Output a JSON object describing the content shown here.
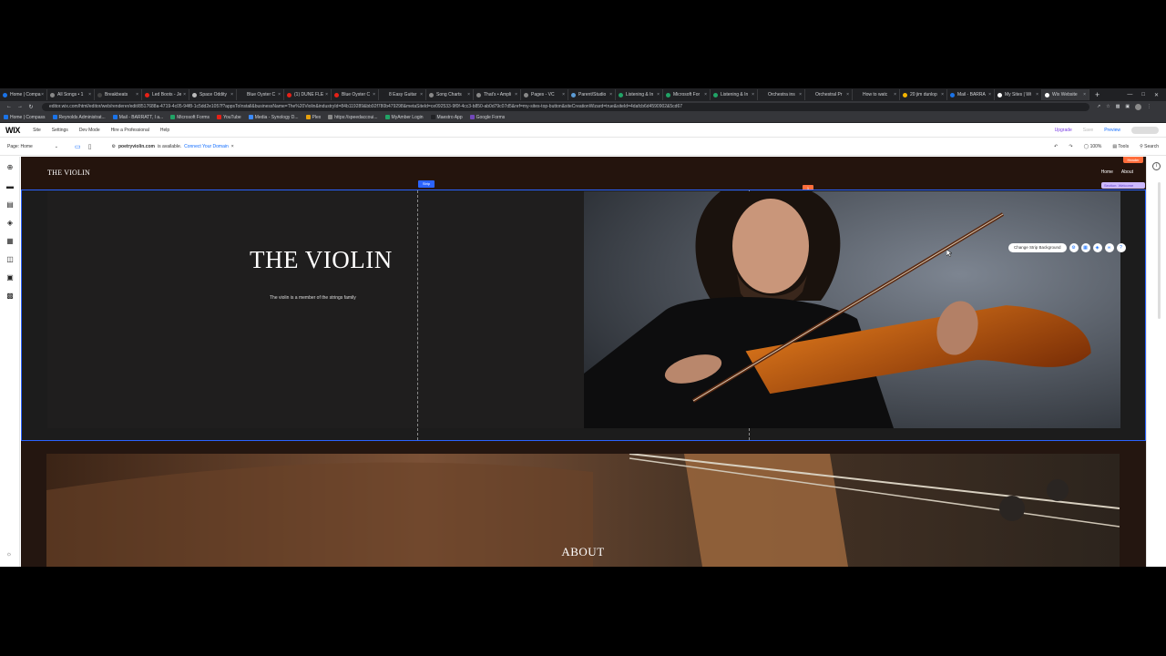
{
  "browser": {
    "tabs": [
      {
        "label": "Home | Compa",
        "color": "#1a73e8",
        "active": false
      },
      {
        "label": "All Songs • 1",
        "color": "#888888",
        "active": false
      },
      {
        "label": "Breakbeats",
        "color": "#444444",
        "active": false
      },
      {
        "label": "Led Boots - Je",
        "color": "#e62117",
        "active": false
      },
      {
        "label": "Space Oddity",
        "color": "#bbbbbb",
        "active": false
      },
      {
        "label": "Blue Oyster C",
        "color": "#202124",
        "active": false
      },
      {
        "label": "(1) DUNE FLE",
        "color": "#e62117",
        "active": false
      },
      {
        "label": "Blue Oyster C",
        "color": "#e62117",
        "active": false
      },
      {
        "label": "8 Easy Guitar",
        "color": "#202124",
        "active": false
      },
      {
        "label": "Song Charts",
        "color": "#888888",
        "active": false
      },
      {
        "label": "That's • Ampli",
        "color": "#888888",
        "active": false
      },
      {
        "label": "Pages - VC",
        "color": "#888888",
        "active": false
      },
      {
        "label": "Parent/Studio",
        "color": "#5b9bd5",
        "active": false
      },
      {
        "label": "Listening & In",
        "color": "#21a366",
        "active": false
      },
      {
        "label": "Microsoft For",
        "color": "#21a366",
        "active": false
      },
      {
        "label": "Listening & In",
        "color": "#21a366",
        "active": false
      },
      {
        "label": "Orchestra ins",
        "color": "#202124",
        "active": false
      },
      {
        "label": "Orchestral Pr",
        "color": "#202124",
        "active": false
      },
      {
        "label": "How to watc",
        "color": "#202124",
        "active": false
      },
      {
        "label": "20 jim dunlop",
        "color": "#f4b400",
        "active": false
      },
      {
        "label": "Mail - BARRA",
        "color": "#1a73e8",
        "active": false
      },
      {
        "label": "My Sites | Wi",
        "color": "#ffffff",
        "active": false
      },
      {
        "label": "Wix Website",
        "color": "#ffffff",
        "active": true
      }
    ],
    "url": "editor.wix.com/html/editor/web/renderer/edit/8517688a-4719-4c05-94f8-1c5dd2e1057f?appsToInstall&businessName=The%20Violin&industryId=84b119289&bb92f780b479298&metaSiteId=ce092533-9f0f-4cc3-b850-ab0d79c07d5&ref=my-sites-top-button&siteCreationWizard=true&siteId=4dafcb6d4590902&5cd67",
    "bookmarks": [
      {
        "label": "Home | Compass",
        "color": "#1a73e8"
      },
      {
        "label": "Reynolds Administrat...",
        "color": "#1a73e8"
      },
      {
        "label": "Mail - BARRATT, I a...",
        "color": "#1a73e8"
      },
      {
        "label": "Microsoft Forms",
        "color": "#21a366"
      },
      {
        "label": "YouTube",
        "color": "#e62117"
      },
      {
        "label": "Media - Synology D...",
        "color": "#3d8bfd"
      },
      {
        "label": "Plex",
        "color": "#e5a00d"
      },
      {
        "label": "https://speedaccoui...",
        "color": "#888888"
      },
      {
        "label": "MyAmber Login",
        "color": "#21a366"
      },
      {
        "label": "Maestro App",
        "color": "#202124"
      },
      {
        "label": "Google Forms",
        "color": "#7248b9"
      }
    ]
  },
  "wix": {
    "logo": "WIX",
    "menu": [
      "Site",
      "Settings",
      "Dev Mode",
      "Hire a Professional",
      "Help"
    ],
    "upgrade": "Upgrade",
    "save": "Save",
    "preview": "Preview",
    "page_select": "Page: Home",
    "domain_bold": "poetryviolin.com",
    "domain_msg": "is available.",
    "domain_link": "Connect Your Domain",
    "zoom": "100%",
    "tools": "Tools",
    "search": "Search"
  },
  "site": {
    "title": "THE VIOLIN",
    "nav": [
      "Home",
      "About"
    ],
    "header_badge": "Header",
    "section_badge": "Section: Welcome",
    "strip_badge": "Strip",
    "strip_marker": "1",
    "hero_title": "THE VIOLIN",
    "hero_sub": "The violin is a member of the strings family",
    "change_bg": "Change Strip Background",
    "about_title": "ABOUT"
  },
  "colors": {
    "wix_blue": "#116dff",
    "selection": "#2b63ff",
    "header_bg": "#24140d",
    "accent_orange": "#ff6d3b"
  }
}
